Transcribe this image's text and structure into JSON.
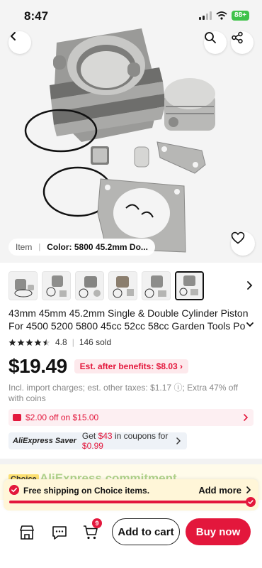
{
  "status_bar": {
    "time": "8:47",
    "battery": "88+"
  },
  "hero": {
    "variant_label": "Item",
    "variant_value": "Color: 5800 45.2mm Do..."
  },
  "thumbnails": {
    "count": 6,
    "active_index": 5
  },
  "product": {
    "title": "43mm 45mm 45.2mm Single & Double Cylinder Piston For 4500 5200 5800 45cc 52cc 58cc Garden Tools Po",
    "rating": "4.8",
    "rating_stars": 4.5,
    "sold": "146 sold",
    "price": "$19.49",
    "benefit_tag": "Est. after benefits: $8.03",
    "tax_note": "Incl. import charges; est. other taxes: $1.17 ⓘ; Extra 47% off with coins"
  },
  "coupon": {
    "text": "$2.00 off on $15.00"
  },
  "saver": {
    "brand": "AliExpress Saver",
    "prefix": "Get ",
    "amount": "$43",
    "middle": " in coupons for ",
    "price": "$0.99"
  },
  "commitment": {
    "tag": "Choice",
    "title": "AliExpress commitment"
  },
  "free_shipping": {
    "text": "Free shipping on  Choice  items.",
    "add_more": "Add more",
    "progress_fraction": 1.0
  },
  "bottom_bar": {
    "cart_count": "9",
    "add_to_cart": "Add to cart",
    "buy_now": "Buy now"
  },
  "colors": {
    "accent": "#e3173c",
    "benefit_bg": "#fde9ec",
    "saver_bg": "#eef2f7",
    "ship_bg": "#fff6d8"
  }
}
